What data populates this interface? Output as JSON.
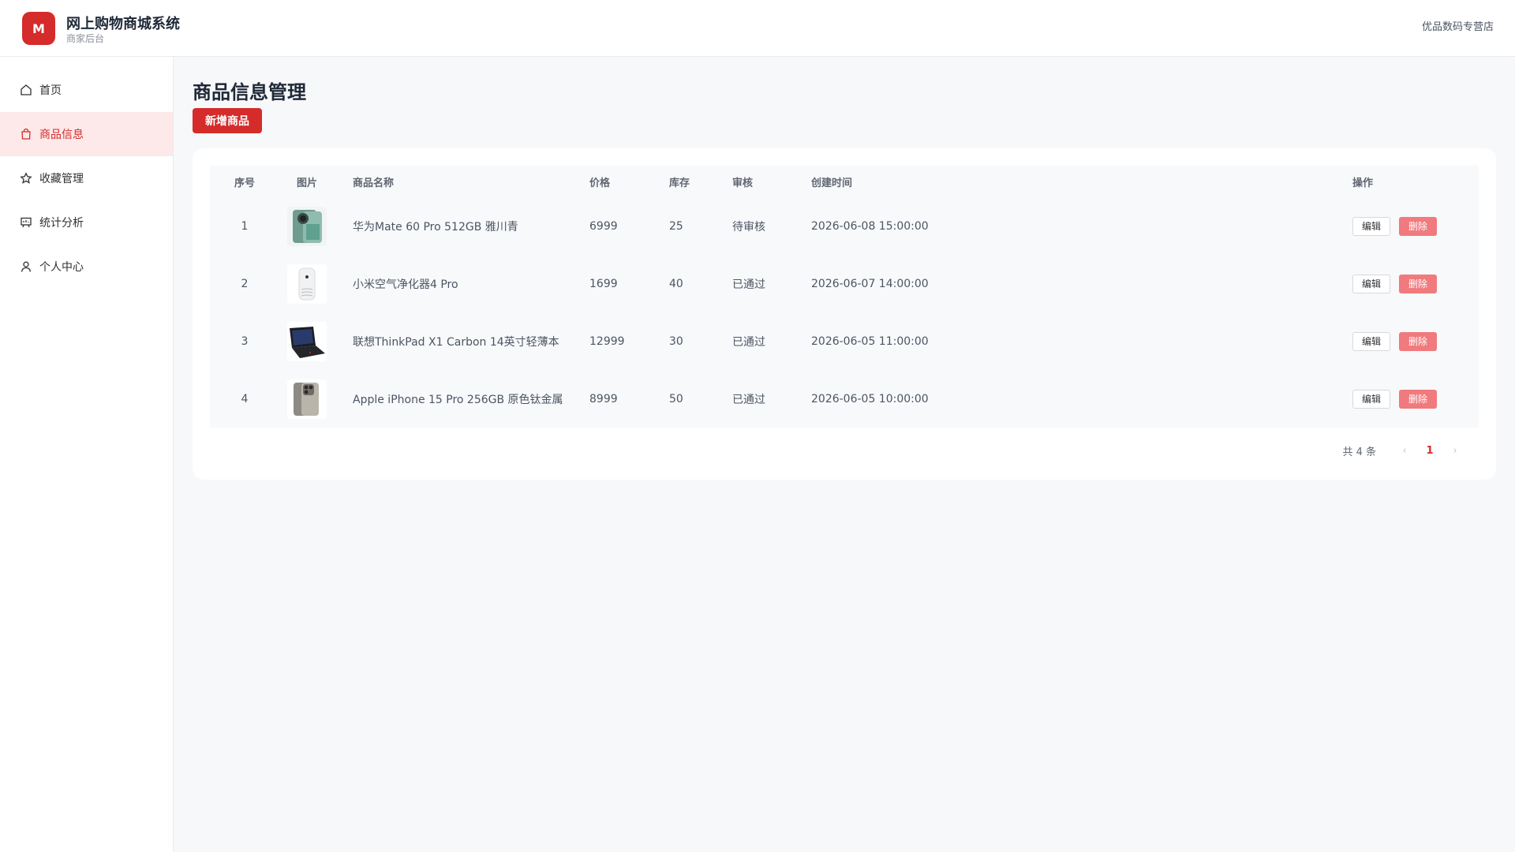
{
  "header": {
    "logo_letter": "M",
    "title": "网上购物商城系统",
    "subtitle": "商家后台",
    "shop_name": "优品数码专营店"
  },
  "sidebar": {
    "items": [
      {
        "label": "首页",
        "icon": "home-icon"
      },
      {
        "label": "商品信息",
        "icon": "shopping-bag-icon",
        "active": true
      },
      {
        "label": "收藏管理",
        "icon": "star-icon"
      },
      {
        "label": "统计分析",
        "icon": "chart-icon"
      },
      {
        "label": "个人中心",
        "icon": "user-icon"
      }
    ]
  },
  "main": {
    "title": "商品信息管理",
    "add_button": "新增商品"
  },
  "table": {
    "headers": [
      "序号",
      "图片",
      "商品名称",
      "价格",
      "库存",
      "审核",
      "创建时间",
      "操作"
    ],
    "rows": [
      {
        "idx": "1",
        "name": "华为Mate 60 Pro 512GB 雅川青",
        "price": "6999",
        "stock": "25",
        "audit": "待审核",
        "time": "2026-06-08 15:00:00",
        "img": "phone-green"
      },
      {
        "idx": "2",
        "name": "小米空气净化器4 Pro",
        "price": "1699",
        "stock": "40",
        "audit": "已通过",
        "time": "2026-06-07 14:00:00",
        "img": "purifier-white"
      },
      {
        "idx": "3",
        "name": "联想ThinkPad X1 Carbon 14英寸轻薄本",
        "price": "12999",
        "stock": "30",
        "audit": "已通过",
        "time": "2026-06-05 11:00:00",
        "img": "laptop-black"
      },
      {
        "idx": "4",
        "name": "Apple iPhone 15 Pro 256GB 原色钛金属",
        "price": "8999",
        "stock": "50",
        "audit": "已通过",
        "time": "2026-06-05 10:00:00",
        "img": "phone-titanium"
      }
    ],
    "edit_label": "编辑",
    "delete_label": "删除"
  },
  "pagination": {
    "total_text": "共 4 条",
    "current_page": "1",
    "prev": "‹",
    "next": "›"
  },
  "colors": {
    "accent": "#d52b2b",
    "active_bg": "#fde9ea",
    "delete_button": "#f07a7d"
  }
}
